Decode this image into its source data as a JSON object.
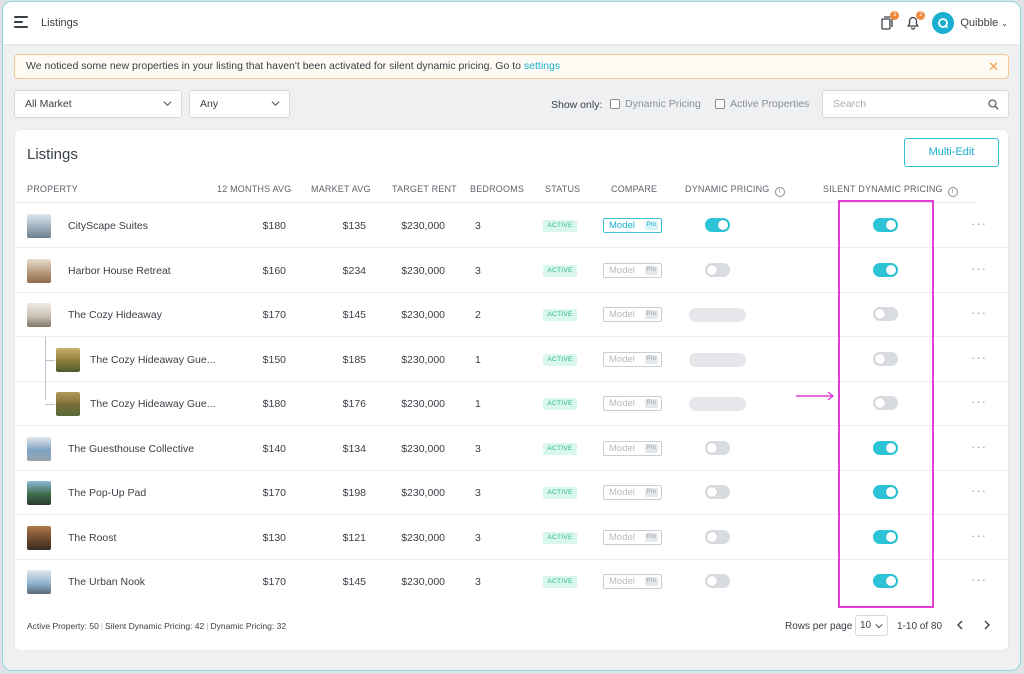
{
  "topbar": {
    "title": "Listings",
    "docs_badge": "1",
    "bell_badge": "2",
    "user_name": "Quibble"
  },
  "banner": {
    "message": "We noticed some new properties in your listing that haven't been activated for silent dynamic pricing. Go to ",
    "link_text": "settings"
  },
  "filters": {
    "market": "All Market",
    "second": "Any",
    "show_only_label": "Show only:",
    "dynamic_pricing_label": "Dynamic Pricing",
    "active_properties_label": "Active Properties",
    "search_placeholder": "Search"
  },
  "listings": {
    "title": "Listings",
    "multi_edit_label": "Multi-Edit",
    "columns": {
      "property": "PROPERTY",
      "avg12": "12 MONTHS AVG",
      "market_avg": "MARKET AVG",
      "target_rent": "TARGET RENT",
      "bedrooms": "BEDROOMS",
      "status": "STATUS",
      "compare": "COMPARE",
      "dynamic_pricing": "DYNAMIC PRICING",
      "silent_dynamic_pricing": "SILENT DYNAMIC PRICING"
    },
    "rows": [
      {
        "name": "CityScape Suites",
        "avg12": "$180",
        "market_avg": "$135",
        "target_rent": "$230,000",
        "bedrooms": "3",
        "status": "ACTIVE",
        "compare": "Model",
        "pro": "Pro",
        "compare_active": true,
        "dynamic": "on",
        "silent": "on",
        "child": false
      },
      {
        "name": "Harbor House Retreat",
        "avg12": "$160",
        "market_avg": "$234",
        "target_rent": "$230,000",
        "bedrooms": "3",
        "status": "ACTIVE",
        "compare": "Model",
        "pro": "Pro",
        "compare_active": false,
        "dynamic": "off",
        "silent": "on",
        "child": false
      },
      {
        "name": "The Cozy Hideaway",
        "avg12": "$170",
        "market_avg": "$145",
        "target_rent": "$230,000",
        "bedrooms": "2",
        "status": "ACTIVE",
        "compare": "Model",
        "pro": "Pro",
        "compare_active": false,
        "dynamic": "disabled",
        "silent": "off",
        "child": false
      },
      {
        "name": "The Cozy Hideaway Gue...",
        "avg12": "$150",
        "market_avg": "$185",
        "target_rent": "$230,000",
        "bedrooms": "1",
        "status": "ACTIVE",
        "compare": "Model",
        "pro": "Pro",
        "compare_active": false,
        "dynamic": "disabled",
        "silent": "off",
        "child": true
      },
      {
        "name": "The Cozy Hideaway Gue...",
        "avg12": "$180",
        "market_avg": "$176",
        "target_rent": "$230,000",
        "bedrooms": "1",
        "status": "ACTIVE",
        "compare": "Model",
        "pro": "Pro",
        "compare_active": false,
        "dynamic": "disabled",
        "silent": "off",
        "child": true
      },
      {
        "name": "The Guesthouse Collective",
        "avg12": "$140",
        "market_avg": "$134",
        "target_rent": "$230,000",
        "bedrooms": "3",
        "status": "ACTIVE",
        "compare": "Model",
        "pro": "Pro",
        "compare_active": false,
        "dynamic": "off",
        "silent": "on",
        "child": false
      },
      {
        "name": "The Pop-Up Pad",
        "avg12": "$170",
        "market_avg": "$198",
        "target_rent": "$230,000",
        "bedrooms": "3",
        "status": "ACTIVE",
        "compare": "Model",
        "pro": "Pro",
        "compare_active": false,
        "dynamic": "off",
        "silent": "on",
        "child": false
      },
      {
        "name": "The Roost",
        "avg12": "$130",
        "market_avg": "$121",
        "target_rent": "$230,000",
        "bedrooms": "3",
        "status": "ACTIVE",
        "compare": "Model",
        "pro": "Pro",
        "compare_active": false,
        "dynamic": "off",
        "silent": "on",
        "child": false
      },
      {
        "name": "The Urban Nook",
        "avg12": "$170",
        "market_avg": "$145",
        "target_rent": "$230,000",
        "bedrooms": "3",
        "status": "ACTIVE",
        "compare": "Model",
        "pro": "Pro",
        "compare_active": false,
        "dynamic": "off",
        "silent": "on",
        "child": false
      }
    ],
    "row_menu_label": "···"
  },
  "footer": {
    "active_property": "Active Property: 50",
    "silent_dynamic": "Silent Dynamic Pricing: 42",
    "dynamic": "Dynamic Pricing: 32",
    "separator": "|",
    "rows_per_page_label": "Rows per page",
    "rows_per_page_value": "10",
    "range": "1-10 of 80"
  },
  "colors": {
    "accent": "#2cc3d6",
    "highlight": "#e33fd6",
    "status_bg": "#d9f7ed",
    "status_text": "#26b882"
  }
}
